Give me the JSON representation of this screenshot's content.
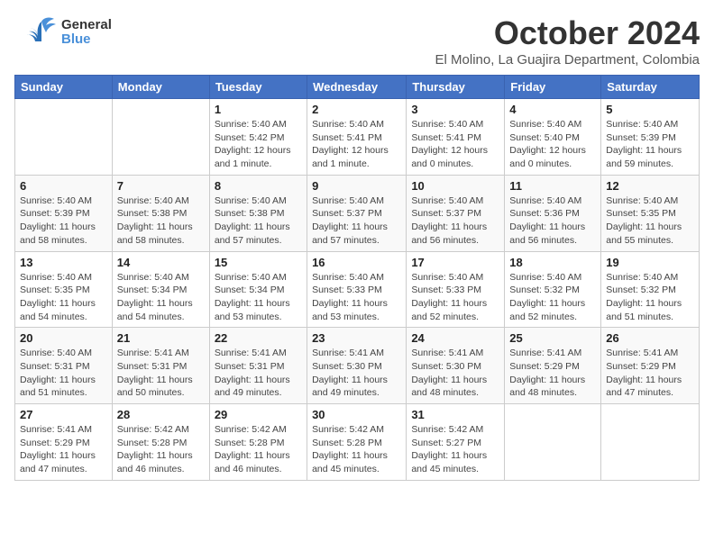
{
  "header": {
    "logo_general": "General",
    "logo_blue": "Blue",
    "month_title": "October 2024",
    "location": "El Molino, La Guajira Department, Colombia"
  },
  "weekdays": [
    "Sunday",
    "Monday",
    "Tuesday",
    "Wednesday",
    "Thursday",
    "Friday",
    "Saturday"
  ],
  "weeks": [
    [
      {
        "day": "",
        "info": ""
      },
      {
        "day": "",
        "info": ""
      },
      {
        "day": "1",
        "info": "Sunrise: 5:40 AM\nSunset: 5:42 PM\nDaylight: 12 hours\nand 1 minute."
      },
      {
        "day": "2",
        "info": "Sunrise: 5:40 AM\nSunset: 5:41 PM\nDaylight: 12 hours\nand 1 minute."
      },
      {
        "day": "3",
        "info": "Sunrise: 5:40 AM\nSunset: 5:41 PM\nDaylight: 12 hours\nand 0 minutes."
      },
      {
        "day": "4",
        "info": "Sunrise: 5:40 AM\nSunset: 5:40 PM\nDaylight: 12 hours\nand 0 minutes."
      },
      {
        "day": "5",
        "info": "Sunrise: 5:40 AM\nSunset: 5:39 PM\nDaylight: 11 hours\nand 59 minutes."
      }
    ],
    [
      {
        "day": "6",
        "info": "Sunrise: 5:40 AM\nSunset: 5:39 PM\nDaylight: 11 hours\nand 58 minutes."
      },
      {
        "day": "7",
        "info": "Sunrise: 5:40 AM\nSunset: 5:38 PM\nDaylight: 11 hours\nand 58 minutes."
      },
      {
        "day": "8",
        "info": "Sunrise: 5:40 AM\nSunset: 5:38 PM\nDaylight: 11 hours\nand 57 minutes."
      },
      {
        "day": "9",
        "info": "Sunrise: 5:40 AM\nSunset: 5:37 PM\nDaylight: 11 hours\nand 57 minutes."
      },
      {
        "day": "10",
        "info": "Sunrise: 5:40 AM\nSunset: 5:37 PM\nDaylight: 11 hours\nand 56 minutes."
      },
      {
        "day": "11",
        "info": "Sunrise: 5:40 AM\nSunset: 5:36 PM\nDaylight: 11 hours\nand 56 minutes."
      },
      {
        "day": "12",
        "info": "Sunrise: 5:40 AM\nSunset: 5:35 PM\nDaylight: 11 hours\nand 55 minutes."
      }
    ],
    [
      {
        "day": "13",
        "info": "Sunrise: 5:40 AM\nSunset: 5:35 PM\nDaylight: 11 hours\nand 54 minutes."
      },
      {
        "day": "14",
        "info": "Sunrise: 5:40 AM\nSunset: 5:34 PM\nDaylight: 11 hours\nand 54 minutes."
      },
      {
        "day": "15",
        "info": "Sunrise: 5:40 AM\nSunset: 5:34 PM\nDaylight: 11 hours\nand 53 minutes."
      },
      {
        "day": "16",
        "info": "Sunrise: 5:40 AM\nSunset: 5:33 PM\nDaylight: 11 hours\nand 53 minutes."
      },
      {
        "day": "17",
        "info": "Sunrise: 5:40 AM\nSunset: 5:33 PM\nDaylight: 11 hours\nand 52 minutes."
      },
      {
        "day": "18",
        "info": "Sunrise: 5:40 AM\nSunset: 5:32 PM\nDaylight: 11 hours\nand 52 minutes."
      },
      {
        "day": "19",
        "info": "Sunrise: 5:40 AM\nSunset: 5:32 PM\nDaylight: 11 hours\nand 51 minutes."
      }
    ],
    [
      {
        "day": "20",
        "info": "Sunrise: 5:40 AM\nSunset: 5:31 PM\nDaylight: 11 hours\nand 51 minutes."
      },
      {
        "day": "21",
        "info": "Sunrise: 5:41 AM\nSunset: 5:31 PM\nDaylight: 11 hours\nand 50 minutes."
      },
      {
        "day": "22",
        "info": "Sunrise: 5:41 AM\nSunset: 5:31 PM\nDaylight: 11 hours\nand 49 minutes."
      },
      {
        "day": "23",
        "info": "Sunrise: 5:41 AM\nSunset: 5:30 PM\nDaylight: 11 hours\nand 49 minutes."
      },
      {
        "day": "24",
        "info": "Sunrise: 5:41 AM\nSunset: 5:30 PM\nDaylight: 11 hours\nand 48 minutes."
      },
      {
        "day": "25",
        "info": "Sunrise: 5:41 AM\nSunset: 5:29 PM\nDaylight: 11 hours\nand 48 minutes."
      },
      {
        "day": "26",
        "info": "Sunrise: 5:41 AM\nSunset: 5:29 PM\nDaylight: 11 hours\nand 47 minutes."
      }
    ],
    [
      {
        "day": "27",
        "info": "Sunrise: 5:41 AM\nSunset: 5:29 PM\nDaylight: 11 hours\nand 47 minutes."
      },
      {
        "day": "28",
        "info": "Sunrise: 5:42 AM\nSunset: 5:28 PM\nDaylight: 11 hours\nand 46 minutes."
      },
      {
        "day": "29",
        "info": "Sunrise: 5:42 AM\nSunset: 5:28 PM\nDaylight: 11 hours\nand 46 minutes."
      },
      {
        "day": "30",
        "info": "Sunrise: 5:42 AM\nSunset: 5:28 PM\nDaylight: 11 hours\nand 45 minutes."
      },
      {
        "day": "31",
        "info": "Sunrise: 5:42 AM\nSunset: 5:27 PM\nDaylight: 11 hours\nand 45 minutes."
      },
      {
        "day": "",
        "info": ""
      },
      {
        "day": "",
        "info": ""
      }
    ]
  ]
}
